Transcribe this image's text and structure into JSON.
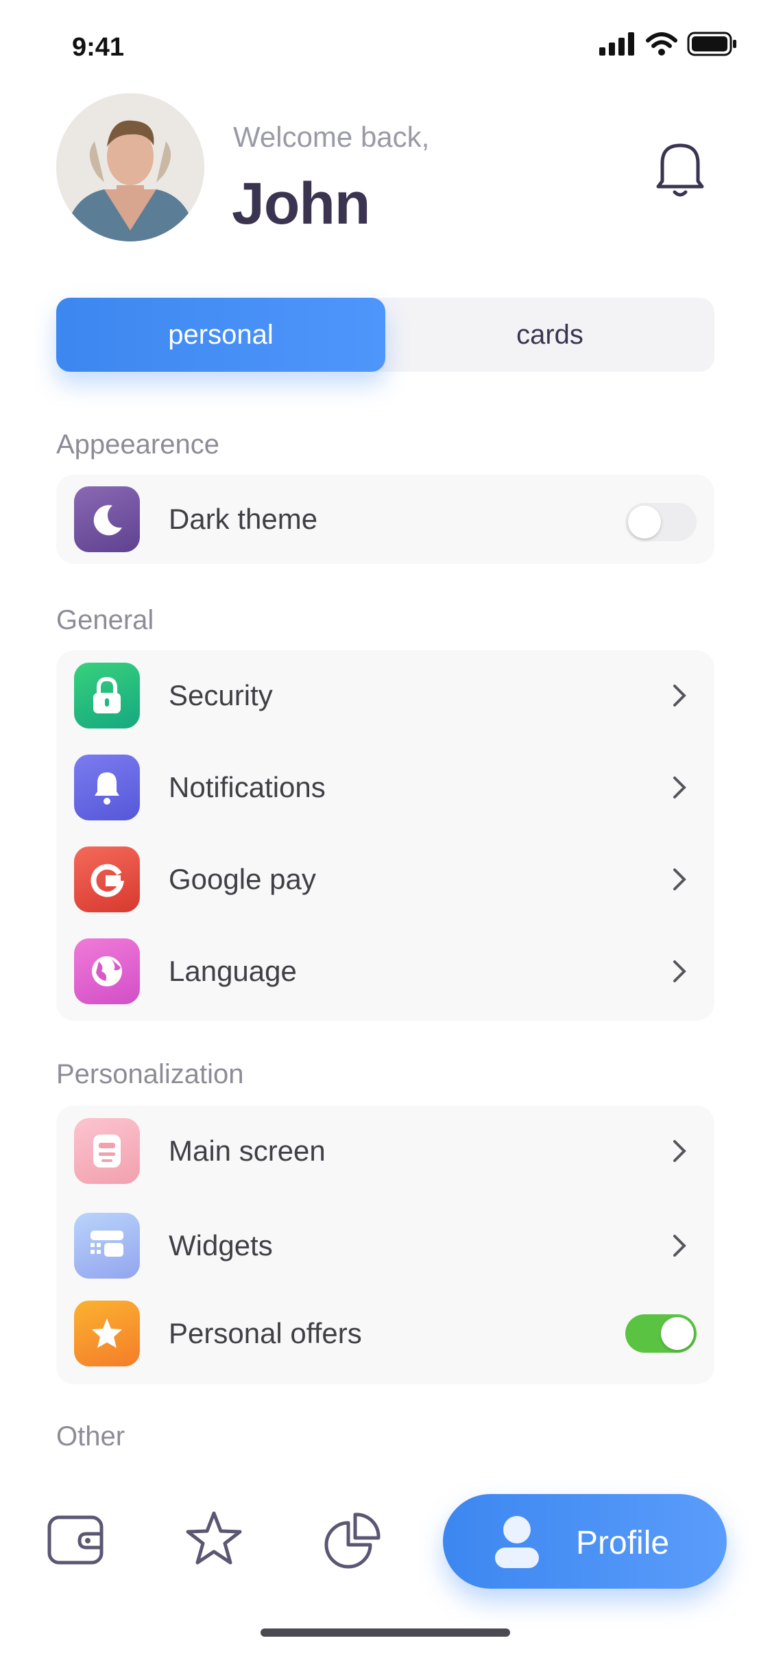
{
  "status_bar": {
    "time": "9:41"
  },
  "header": {
    "welcome": "Welcome back,",
    "name": "John"
  },
  "tabs": [
    {
      "label": "personal",
      "active": true
    },
    {
      "label": "cards",
      "active": false
    }
  ],
  "sections": {
    "appearance": {
      "title": "Appeearence",
      "items": [
        {
          "label": "Dark theme",
          "icon": "moon-icon",
          "toggle": false
        }
      ]
    },
    "general": {
      "title": "General",
      "items": [
        {
          "label": "Security",
          "icon": "lock-icon"
        },
        {
          "label": "Notifications",
          "icon": "bell-icon"
        },
        {
          "label": "Google pay",
          "icon": "google-icon"
        },
        {
          "label": "Language",
          "icon": "globe-icon"
        }
      ]
    },
    "personalization": {
      "title": "Personalization",
      "items": [
        {
          "label": "Main screen",
          "icon": "screen-icon"
        },
        {
          "label": "Widgets",
          "icon": "widgets-icon"
        },
        {
          "label": "Personal offers",
          "icon": "star-icon",
          "toggle": true
        }
      ]
    },
    "other": {
      "title": "Other"
    }
  },
  "bottom_nav": {
    "items": [
      {
        "icon": "wallet-icon"
      },
      {
        "icon": "star-icon"
      },
      {
        "icon": "pie-chart-icon"
      }
    ],
    "profile_label": "Profile"
  },
  "colors": {
    "accent": "#4a90f6",
    "toggle_on": "#5ac442",
    "title_dark": "#3b3450"
  }
}
